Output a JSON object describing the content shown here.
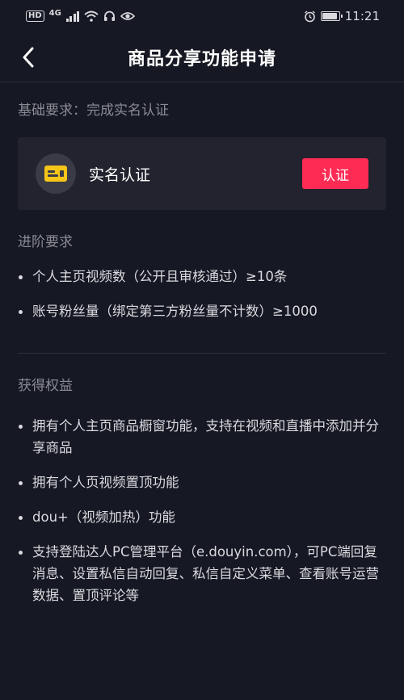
{
  "status_bar": {
    "hd": "HD",
    "network": "4G",
    "time": "11:21",
    "battery_level": 0.9,
    "icons": [
      "signal-icon",
      "wifi-icon",
      "headset-icon",
      "eye-icon",
      "alarm-icon",
      "battery-icon"
    ]
  },
  "header": {
    "title": "商品分享功能申请",
    "back_icon": "chevron-left-icon"
  },
  "basic": {
    "label": "基础要求：完成实名认证",
    "card_label": "实名认证",
    "card_icon": "id-card-icon",
    "button_label": "认证"
  },
  "advanced": {
    "label": "进阶要求",
    "items": [
      "个人主页视频数（公开且审核通过）≥10条",
      "账号粉丝量（绑定第三方粉丝量不计数）≥1000"
    ]
  },
  "benefits": {
    "label": "获得权益",
    "items": [
      "拥有个人主页商品橱窗功能，支持在视频和直播中添加并分享商品",
      "拥有个人页视频置顶功能",
      "dou+（视频加热）功能",
      "支持登陆达人PC管理平台（e.douyin.com），可PC端回复消息、设置私信自动回复、私信自定义菜单、查看账号运营数据、置顶评论等"
    ]
  },
  "colors": {
    "background": "#161823",
    "card": "#22232e",
    "accent": "#fe2c55",
    "icon_yellow": "#f5c518"
  }
}
